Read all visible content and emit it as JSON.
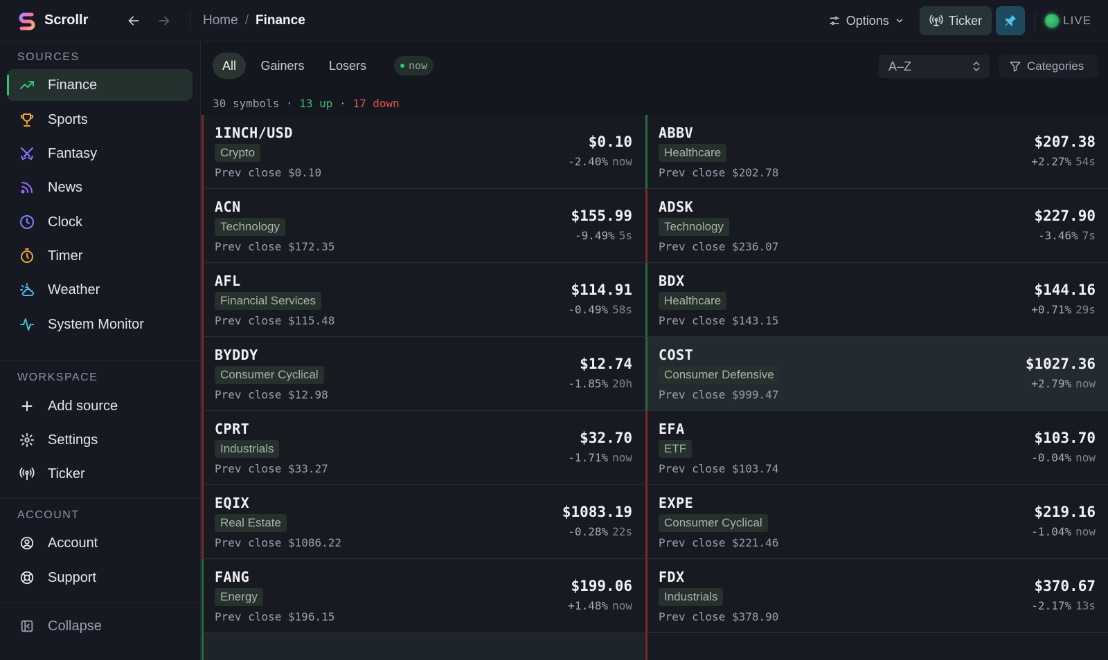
{
  "app": {
    "name": "Scrollr"
  },
  "breadcrumb": {
    "home": "Home",
    "separator": "/",
    "current": "Finance"
  },
  "topbar": {
    "options_label": "Options",
    "ticker_label": "Ticker",
    "live_label": "LIVE"
  },
  "sidebar": {
    "sources_title": "SOURCES",
    "sources": [
      {
        "label": "Finance",
        "icon": "trending-up-icon"
      },
      {
        "label": "Sports",
        "icon": "trophy-icon"
      },
      {
        "label": "Fantasy",
        "icon": "swords-icon"
      },
      {
        "label": "News",
        "icon": "rss-icon"
      },
      {
        "label": "Clock",
        "icon": "clock-icon"
      },
      {
        "label": "Timer",
        "icon": "timer-icon"
      },
      {
        "label": "Weather",
        "icon": "cloud-sun-icon"
      },
      {
        "label": "System Monitor",
        "icon": "activity-icon"
      }
    ],
    "workspace_title": "WORKSPACE",
    "workspace": [
      {
        "label": "Add source",
        "icon": "plus-icon"
      },
      {
        "label": "Settings",
        "icon": "gear-icon"
      },
      {
        "label": "Ticker",
        "icon": "antenna-icon"
      }
    ],
    "account_title": "ACCOUNT",
    "account": [
      {
        "label": "Account",
        "icon": "user-circle-icon"
      },
      {
        "label": "Support",
        "icon": "lifebuoy-icon"
      }
    ],
    "collapse_label": "Collapse"
  },
  "filters": {
    "tabs": [
      "All",
      "Gainers",
      "Losers"
    ],
    "now_label": "now",
    "sort_value": "A–Z",
    "categories_label": "Categories"
  },
  "summary": {
    "symbols": "30 symbols",
    "sep": "·",
    "up": "13 up",
    "down": "17 down"
  },
  "colors": {
    "up": "#34c46f",
    "down": "#e5534b",
    "accent": "#1f4a5e"
  },
  "cards": [
    {
      "symbol": "1INCH/USD",
      "category": "Crypto",
      "prev": "Prev close $0.10",
      "price": "$0.10",
      "change": "-2.40%",
      "age": "now"
    },
    {
      "symbol": "ABBV",
      "category": "Healthcare",
      "prev": "Prev close $202.78",
      "price": "$207.38",
      "change": "+2.27%",
      "age": "54s"
    },
    {
      "symbol": "ACN",
      "category": "Technology",
      "prev": "Prev close $172.35",
      "price": "$155.99",
      "change": "-9.49%",
      "age": "5s"
    },
    {
      "symbol": "ADSK",
      "category": "Technology",
      "prev": "Prev close $236.07",
      "price": "$227.90",
      "change": "-3.46%",
      "age": "7s"
    },
    {
      "symbol": "AFL",
      "category": "Financial Services",
      "prev": "Prev close $115.48",
      "price": "$114.91",
      "change": "-0.49%",
      "age": "58s"
    },
    {
      "symbol": "BDX",
      "category": "Healthcare",
      "prev": "Prev close $143.15",
      "price": "$144.16",
      "change": "+0.71%",
      "age": "29s"
    },
    {
      "symbol": "BYDDY",
      "category": "Consumer Cyclical",
      "prev": "Prev close $12.98",
      "price": "$12.74",
      "change": "-1.85%",
      "age": "20h"
    },
    {
      "symbol": "COST",
      "category": "Consumer Defensive",
      "prev": "Prev close $999.47",
      "price": "$1027.36",
      "change": "+2.79%",
      "age": "now"
    },
    {
      "symbol": "CPRT",
      "category": "Industrials",
      "prev": "Prev close $33.27",
      "price": "$32.70",
      "change": "-1.71%",
      "age": "now"
    },
    {
      "symbol": "EFA",
      "category": "ETF",
      "prev": "Prev close $103.74",
      "price": "$103.70",
      "change": "-0.04%",
      "age": "now"
    },
    {
      "symbol": "EQIX",
      "category": "Real Estate",
      "prev": "Prev close $1086.22",
      "price": "$1083.19",
      "change": "-0.28%",
      "age": "22s"
    },
    {
      "symbol": "EXPE",
      "category": "Consumer Cyclical",
      "prev": "Prev close $221.46",
      "price": "$219.16",
      "change": "-1.04%",
      "age": "now"
    },
    {
      "symbol": "FANG",
      "category": "Energy",
      "prev": "Prev close $196.15",
      "price": "$199.06",
      "change": "+1.48%",
      "age": "now"
    },
    {
      "symbol": "FDX",
      "category": "Industrials",
      "prev": "Prev close $378.90",
      "price": "$370.67",
      "change": "-2.17%",
      "age": "13s"
    }
  ]
}
